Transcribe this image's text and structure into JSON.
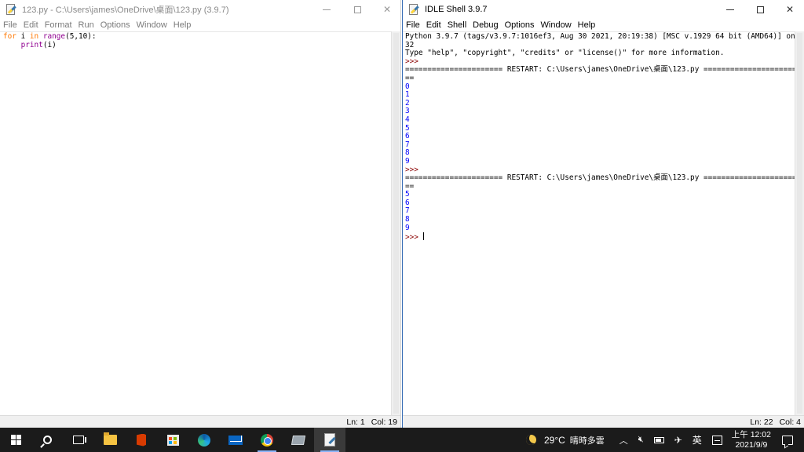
{
  "editor": {
    "title": "123.py - C:\\Users\\james\\OneDrive\\桌面\\123.py (3.9.7)",
    "menu": [
      "File",
      "Edit",
      "Format",
      "Run",
      "Options",
      "Window",
      "Help"
    ],
    "code": {
      "line1": {
        "kw1": "for",
        "sp1": " i ",
        "kw2": "in",
        "sp2": " ",
        "bi": "range",
        "rest": "(5,10):"
      },
      "line2": {
        "indent": "    ",
        "bi": "print",
        "rest": "(i)"
      }
    },
    "status": {
      "ln": "Ln: 1",
      "col": "Col: 19"
    }
  },
  "shell": {
    "title": "IDLE Shell 3.9.7",
    "menu": [
      "File",
      "Edit",
      "Shell",
      "Debug",
      "Options",
      "Window",
      "Help"
    ],
    "banner1": "Python 3.9.7 (tags/v3.9.7:1016ef3, Aug 30 2021, 20:19:38) [MSC v.1929 64 bit (AMD64)] on win",
    "banner2": "32",
    "banner3": "Type \"help\", \"copyright\", \"credits\" or \"license()\" for more information.",
    "prompt": ">>>",
    "restart_line": "====================== RESTART: C:\\Users\\james\\OneDrive\\桌面\\123.py ======================",
    "restart_tail": "==",
    "run1_output": [
      "0",
      "1",
      "2",
      "3",
      "4",
      "5",
      "6",
      "7",
      "8",
      "9"
    ],
    "run2_output": [
      "5",
      "6",
      "7",
      "8",
      "9"
    ],
    "status": {
      "ln": "Ln: 22",
      "col": "Col: 4"
    }
  },
  "taskbar": {
    "apps": [
      "start-icon",
      "search-icon",
      "task-view-icon",
      "file-explorer-icon",
      "office-icon",
      "store-icon",
      "edge-icon",
      "mail-icon",
      "chrome-icon",
      "app-icon",
      "idle-icon"
    ],
    "weather": {
      "temp": "29°C",
      "desc": "晴時多雲"
    },
    "ime": "英",
    "clock": {
      "time": "上午 12:02",
      "date": "2021/9/9"
    }
  }
}
